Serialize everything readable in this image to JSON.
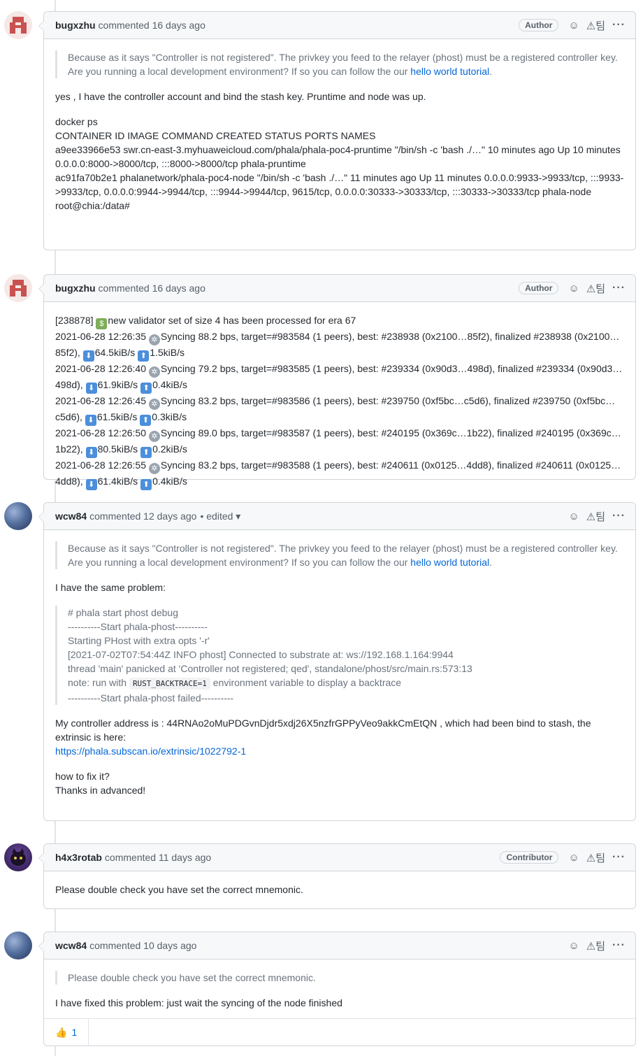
{
  "comments": [
    {
      "author": "bugxzhu",
      "meta": "commented 16 days ago",
      "badge": "Author",
      "quote": "Because as it says \"Controller is not registered\". The privkey you feed to the relayer (phost) must be a registered controller key. Are you running a local development environment? If so you can follow the our ",
      "quote_link": "hello world tutorial",
      "quote_end": ".",
      "para1": "yes , I have the controller account and bind the stash key. Pruntime and node was up.",
      "lines": [
        "docker ps",
        "CONTAINER ID IMAGE COMMAND CREATED STATUS PORTS NAMES",
        "a9ee33966e53 swr.cn-east-3.myhuaweicloud.com/phala/phala-poc4-pruntime \"/bin/sh -c 'bash ./…\" 10 minutes ago Up 10 minutes 0.0.0.0:8000->8000/tcp, :::8000->8000/tcp phala-pruntime",
        "ac91fa70b2e1 phalanetwork/phala-poc4-node \"/bin/sh -c 'bash ./…\" 11 minutes ago Up 11 minutes 0.0.0.0:9933->9933/tcp, :::9933->9933/tcp, 0.0.0.0:9944->9944/tcp, :::9944->9944/tcp, 9615/tcp, 0.0.0.0:30333->30333/tcp, :::30333->30333/tcp phala-node",
        "root@chia:/data#"
      ]
    },
    {
      "author": "bugxzhu",
      "meta": "commented 16 days ago",
      "badge": "Author",
      "first": "[238878] ",
      "first_rest": "new validator set of size 4 has been processed for era 67",
      "logs": [
        {
          "ts": "2021-06-28 12:26:35 ",
          "sync": "Syncing 88.2 bps, target=#983584 (1 peers), best: #238938 (0x2100…85f2), finalized #238938 (0x2100…85f2), ",
          "down": "64.5kiB/s ",
          "up": "1.5kiB/s"
        },
        {
          "ts": "2021-06-28 12:26:40 ",
          "sync": "Syncing 79.2 bps, target=#983585 (1 peers), best: #239334 (0x90d3…498d), finalized #239334 (0x90d3…498d), ",
          "down": "61.9kiB/s ",
          "up": "0.4kiB/s"
        },
        {
          "ts": "2021-06-28 12:26:45 ",
          "sync": "Syncing 83.2 bps, target=#983586 (1 peers), best: #239750 (0xf5bc…c5d6), finalized #239750 (0xf5bc…c5d6), ",
          "down": "61.5kiB/s ",
          "up": "0.3kiB/s"
        },
        {
          "ts": "2021-06-28 12:26:50 ",
          "sync": "Syncing 89.0 bps, target=#983587 (1 peers), best: #240195 (0x369c…1b22), finalized #240195 (0x369c…1b22), ",
          "down": "80.5kiB/s ",
          "up": "0.2kiB/s"
        },
        {
          "ts": "2021-06-28 12:26:55 ",
          "sync": "Syncing 83.2 bps, target=#983588 (1 peers), best: #240611 (0x0125…4dd8), finalized #240611 (0x0125…4dd8), ",
          "down": "61.4kiB/s ",
          "up": "0.4kiB/s"
        }
      ]
    },
    {
      "author": "wcw84",
      "meta": "commented 12 days ago",
      "edited": "• edited",
      "quote": "Because as it says \"Controller is not registered\". The privkey you feed to the relayer (phost) must be a registered controller key. Are you running a local development environment? If so you can follow the our ",
      "quote_link": "hello world tutorial",
      "quote_end": ".",
      "para1": "I have the same problem:",
      "quote2": [
        "# phala start phost debug",
        "----------Start phala-phost----------",
        "Starting PHost with extra opts '-r'",
        "[2021-07-02T07:54:44Z INFO phost] Connected to substrate at: ws://192.168.1.164:9944",
        "thread 'main' panicked at 'Controller not registered; qed', standalone/phost/src/main.rs:573:13"
      ],
      "note_pre": "note: run with ",
      "note_code": "RUST_BACKTRACE=1",
      "note_post": " environment variable to display a backtrace",
      "quote2_last": "----------Start phala-phost failed----------",
      "para2": "My controller address is : 44RNAo2oMuPDGvnDjdr5xdj26X5nzfrGPPyVeo9akkCmEtQN , which had been bind to stash, the extrinsic is here:",
      "link": "https://phala.subscan.io/extrinsic/1022792-1",
      "para3a": "how to fix it?",
      "para3b": "Thanks in advanced!"
    },
    {
      "author": "h4x3rotab",
      "meta": "commented 11 days ago",
      "badge": "Contributor",
      "text": "Please double check you have set the correct mnemonic."
    },
    {
      "author": "wcw84",
      "meta": "commented 10 days ago",
      "quote": "Please double check you have set the correct mnemonic.",
      "text": "I have fixed this problem: just wait the syncing of the node finished",
      "reaction_count": "1"
    }
  ],
  "icons": {
    "smiley": "smiley-icon",
    "triangle_badge": "warning-triangle-icon",
    "more": "kebab-horizontal-icon",
    "thumbs_up": "thumbs-up-icon",
    "dropdown": "triangle-down-icon",
    "arrow_down": "arrow-down-emoji",
    "arrow_up": "arrow-up-emoji",
    "gear": "gear-emoji",
    "money": "money-with-wings-emoji"
  },
  "header_icon_text": {
    "smiley": "☺",
    "tri": "⚠︎팀",
    "more": "···",
    "caret": "▾",
    "thumb": "👍"
  }
}
